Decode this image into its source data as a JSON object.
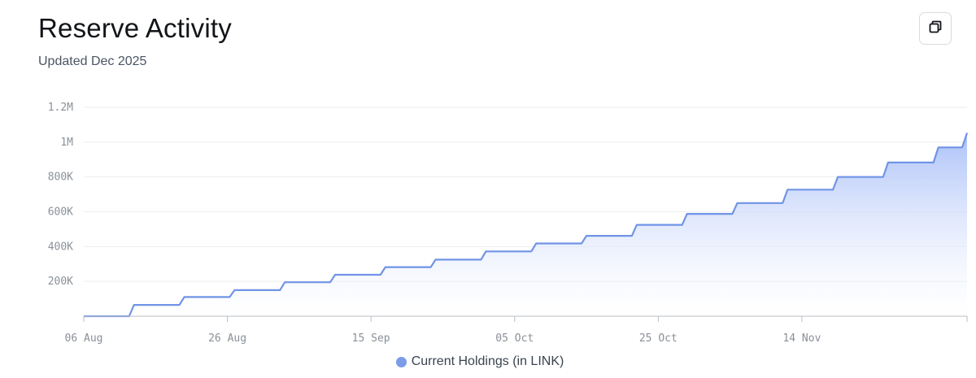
{
  "header": {
    "title": "Reserve Activity",
    "subtitle": "Updated Dec 2025",
    "copy_icon": "copy-icon"
  },
  "legend": {
    "label": "Current Holdings (in LINK)",
    "color": "#7b9ce9"
  },
  "chart_data": {
    "type": "area",
    "title": "Reserve Activity",
    "subtitle": "Updated Dec 2025",
    "xlabel": "",
    "ylabel": "",
    "grid": true,
    "legend_placement": "bottom-center",
    "color_line": "#7094e6",
    "color_fill_top": "#a6bdf7",
    "color_fill_bottom": "#ffffff",
    "x_start": "2025-08-06",
    "xlim": [
      "2025-08-06",
      "2025-12-07"
    ],
    "ylim": [
      0,
      1200000
    ],
    "y_ticks": [
      200000,
      400000,
      600000,
      800000,
      1000000,
      1200000
    ],
    "y_tick_labels": [
      "200K",
      "400K",
      "600K",
      "800K",
      "1M",
      "1.2M"
    ],
    "x_ticks": [
      "2025-08-06",
      "2025-08-26",
      "2025-09-15",
      "2025-10-05",
      "2025-10-25",
      "2025-11-14"
    ],
    "x_tick_labels": [
      "06 Aug",
      "26 Aug",
      "15 Sep",
      "05 Oct",
      "25 Oct",
      "14 Nov"
    ],
    "series": [
      {
        "name": "Current Holdings (in LINK)",
        "points": [
          {
            "x": "2025-08-06",
            "y": 0
          },
          {
            "x": "2025-08-13",
            "y": 65000
          },
          {
            "x": "2025-08-20",
            "y": 110000
          },
          {
            "x": "2025-08-27",
            "y": 150000
          },
          {
            "x": "2025-09-03",
            "y": 195000
          },
          {
            "x": "2025-09-10",
            "y": 238000
          },
          {
            "x": "2025-09-17",
            "y": 282000
          },
          {
            "x": "2025-09-24",
            "y": 325000
          },
          {
            "x": "2025-10-01",
            "y": 372000
          },
          {
            "x": "2025-10-08",
            "y": 418000
          },
          {
            "x": "2025-10-15",
            "y": 462000
          },
          {
            "x": "2025-10-22",
            "y": 525000
          },
          {
            "x": "2025-10-29",
            "y": 588000
          },
          {
            "x": "2025-11-05",
            "y": 650000
          },
          {
            "x": "2025-11-12",
            "y": 727000
          },
          {
            "x": "2025-11-19",
            "y": 800000
          },
          {
            "x": "2025-11-26",
            "y": 883000
          },
          {
            "x": "2025-12-03",
            "y": 970000
          },
          {
            "x": "2025-12-07",
            "y": 1053000
          }
        ]
      }
    ]
  }
}
